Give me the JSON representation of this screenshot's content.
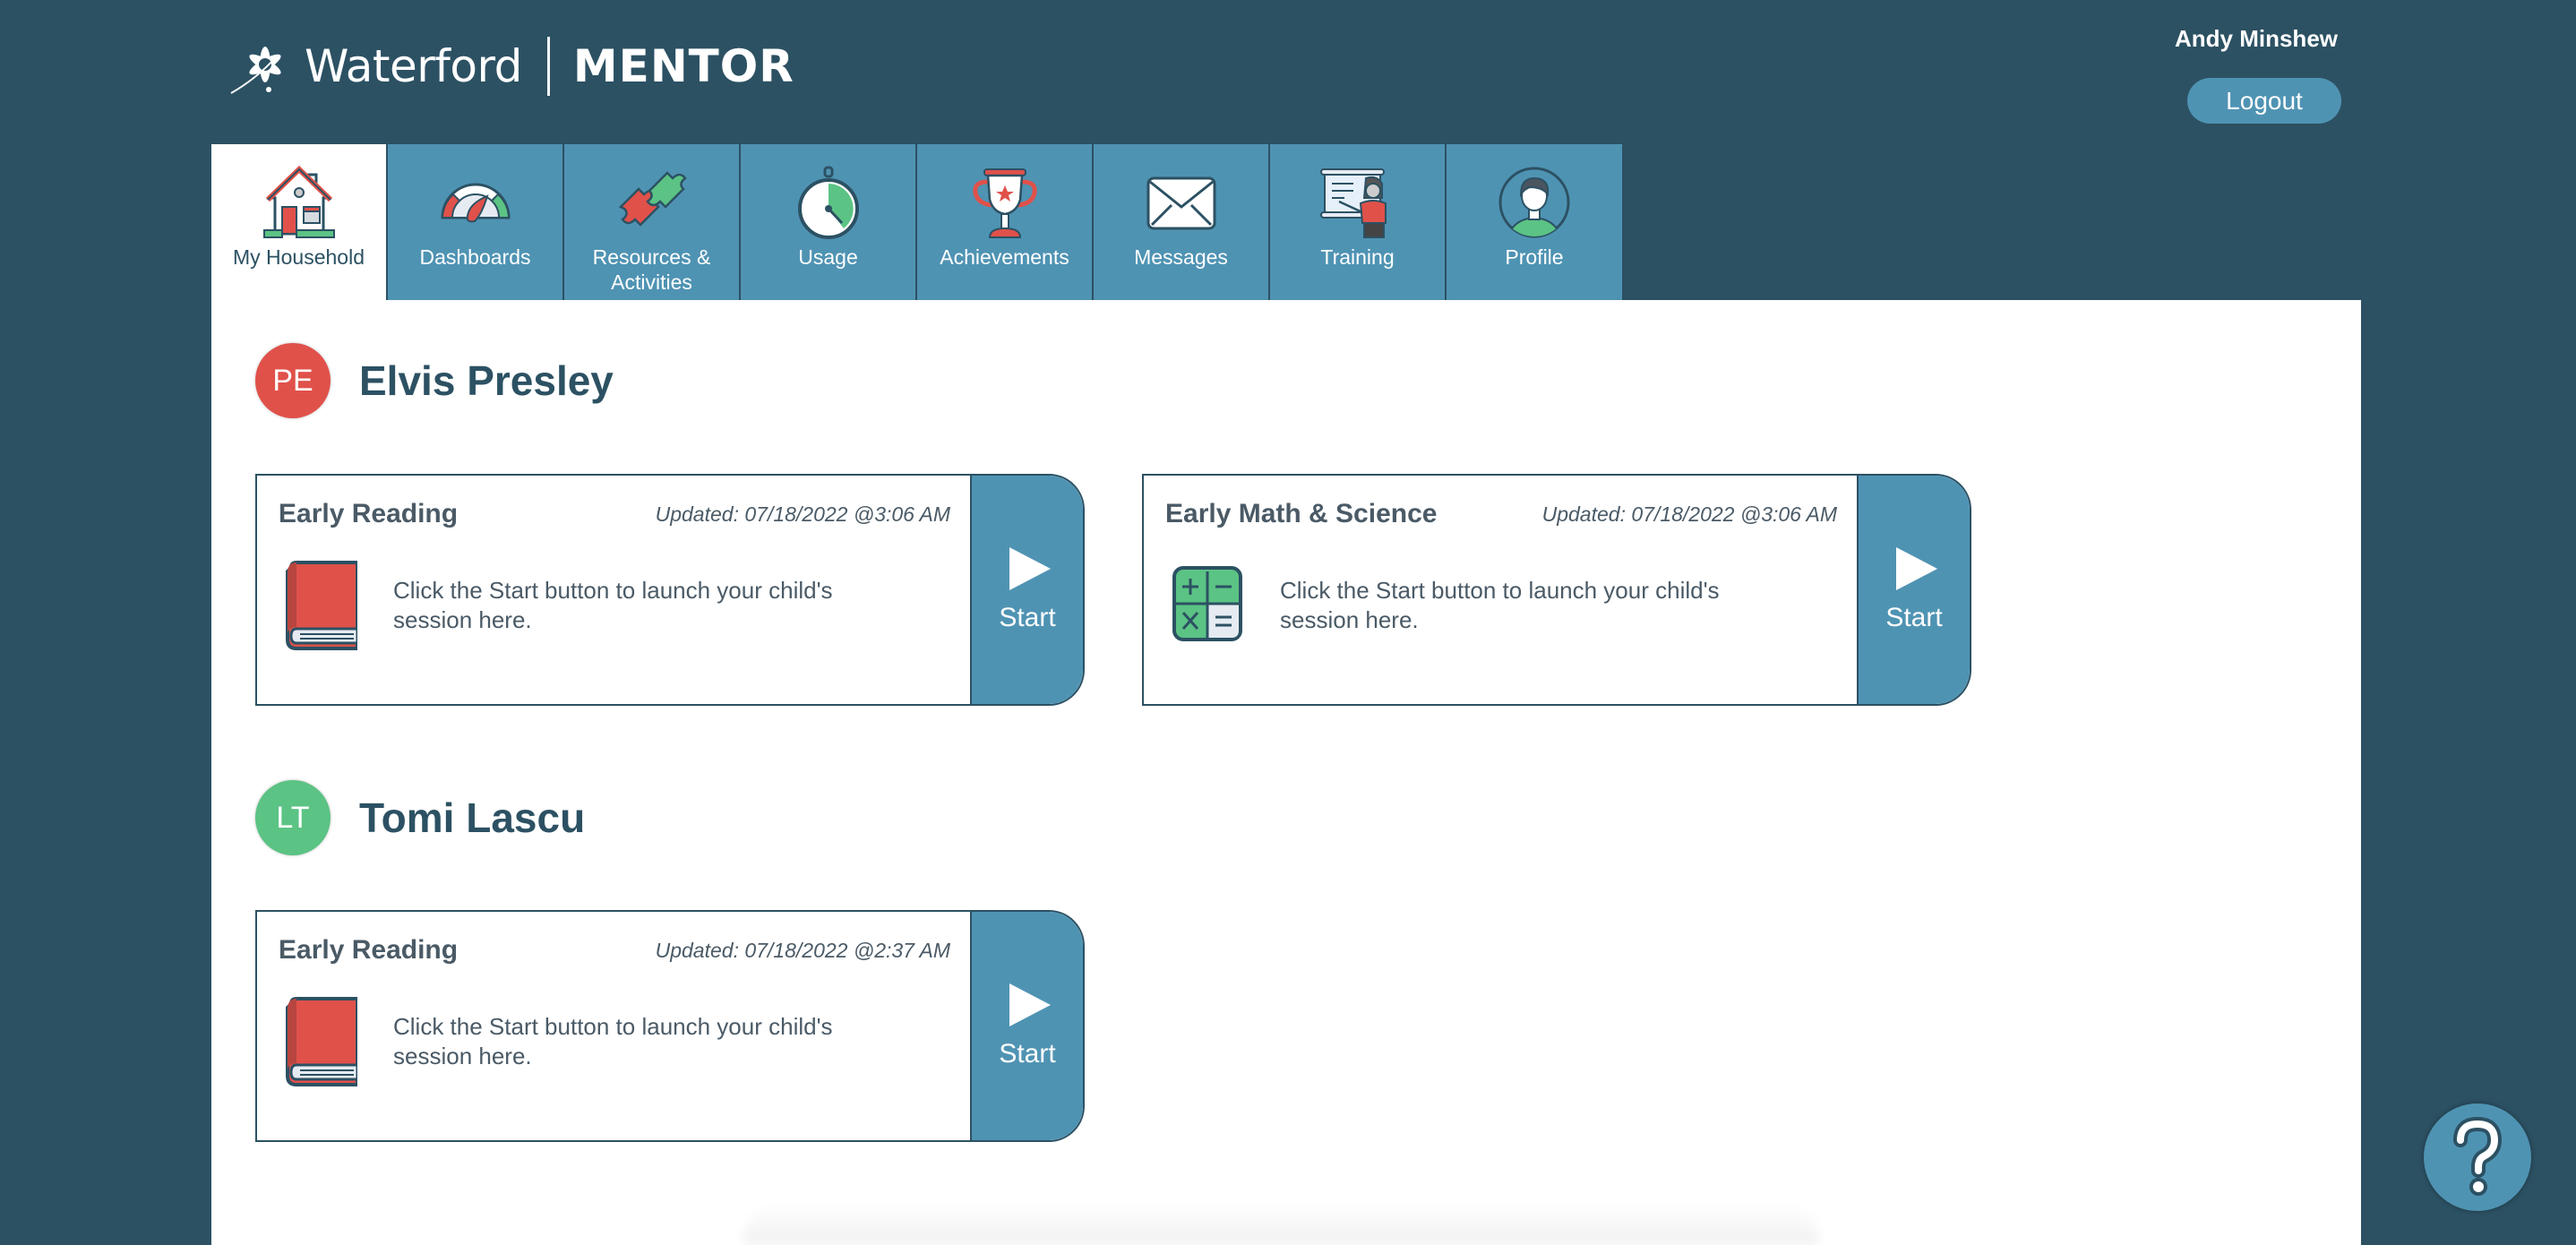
{
  "brand": {
    "name": "Waterford",
    "product": "MENTOR"
  },
  "user": {
    "name": "Andy Minshew",
    "logout_label": "Logout"
  },
  "nav": {
    "tabs": [
      {
        "label": "My Household",
        "icon": "house-icon",
        "active": true
      },
      {
        "label": "Dashboards",
        "icon": "gauge-icon",
        "active": false
      },
      {
        "label": "Resources & Activities",
        "icon": "puzzle-icon",
        "active": false
      },
      {
        "label": "Usage",
        "icon": "stopwatch-icon",
        "active": false
      },
      {
        "label": "Achievements",
        "icon": "trophy-icon",
        "active": false
      },
      {
        "label": "Messages",
        "icon": "envelope-icon",
        "active": false
      },
      {
        "label": "Training",
        "icon": "teacher-icon",
        "active": false
      },
      {
        "label": "Profile",
        "icon": "profile-icon",
        "active": false
      }
    ]
  },
  "children": [
    {
      "initials": "PE",
      "name": "Elvis Presley",
      "avatar_color": "#e0514a",
      "programs": [
        {
          "title": "Early Reading",
          "updated": "Updated: 07/18/2022 @3:06 AM",
          "description": "Click the Start button to launch your child's session here.",
          "icon": "book-icon",
          "start_label": "Start"
        },
        {
          "title": "Early Math & Science",
          "updated": "Updated: 07/18/2022 @3:06 AM",
          "description": "Click the Start button to launch your child's session here.",
          "icon": "math-icon",
          "start_label": "Start"
        }
      ]
    },
    {
      "initials": "LT",
      "name": "Tomi Lascu",
      "avatar_color": "#5bc384",
      "programs": [
        {
          "title": "Early Reading",
          "updated": "Updated: 07/18/2022 @2:37 AM",
          "description": "Click the Start button to launch your child's session here.",
          "icon": "book-icon",
          "start_label": "Start"
        }
      ]
    }
  ],
  "help": {
    "icon": "help-icon"
  },
  "colors": {
    "background": "#2c5163",
    "accent": "#4f93b3",
    "red": "#e0514a",
    "green": "#5bc384"
  }
}
